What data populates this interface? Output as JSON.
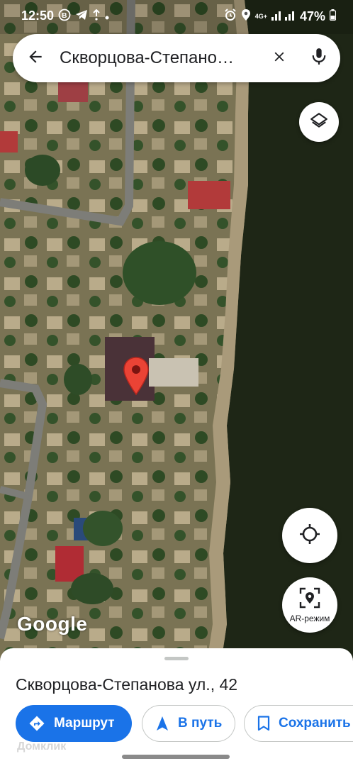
{
  "status_bar": {
    "time": "12:50",
    "left_icons": [
      "b-icon",
      "telegram-icon",
      "notification-icon",
      "dot-icon"
    ],
    "network": "4G+",
    "battery": "47%"
  },
  "search": {
    "query": "Скворцова-Степано…"
  },
  "map": {
    "provider_logo": "Google",
    "water_color": "#1c2414",
    "land_color": "#6e6a48"
  },
  "controls": {
    "ar_label": "AR-режим"
  },
  "place": {
    "title": "Скворцова-Степанова ул., 42"
  },
  "actions": {
    "route_label": "Маршрут",
    "go_label": "В путь",
    "save_label": "Сохранить"
  },
  "watermark": "Домклик",
  "colors": {
    "accent": "#1a73e8",
    "pin": "#ea4335"
  }
}
